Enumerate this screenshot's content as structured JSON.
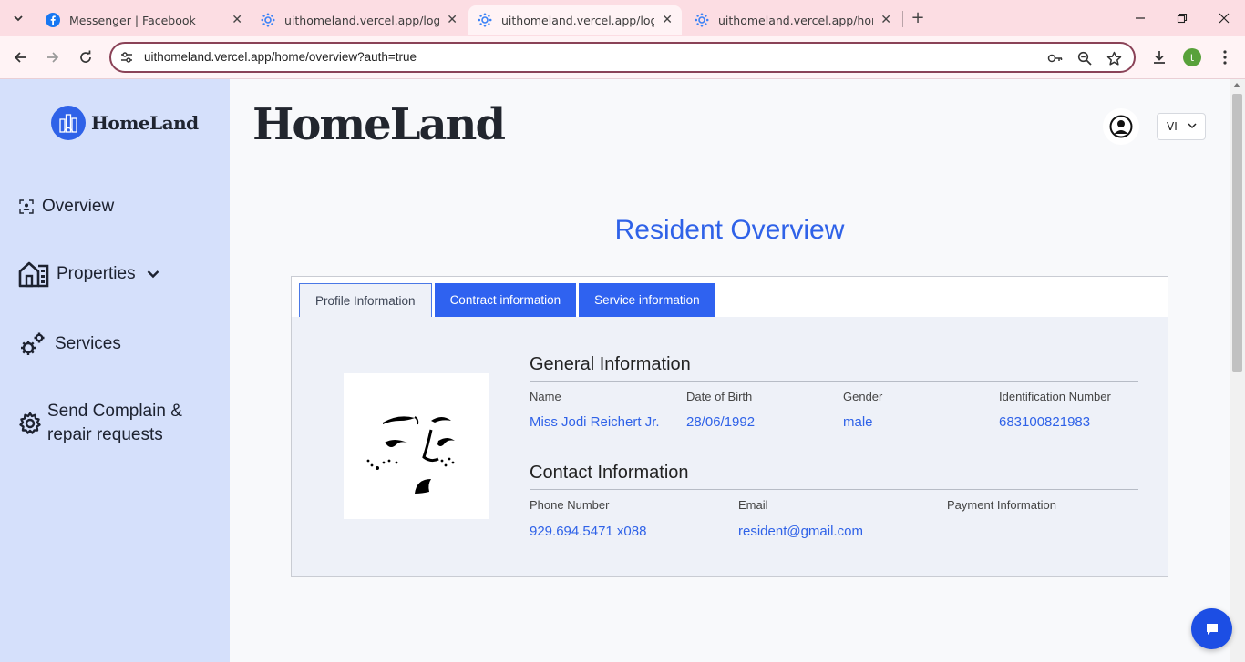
{
  "browser": {
    "tabs": [
      {
        "title": "Messenger | Facebook",
        "active": false,
        "favicon": "facebook-icon"
      },
      {
        "title": "uithomeland.vercel.app/login",
        "active": false,
        "favicon": "vercel-gear-icon"
      },
      {
        "title": "uithomeland.vercel.app/login",
        "active": true,
        "favicon": "vercel-gear-icon"
      },
      {
        "title": "uithomeland.vercel.app/home/o",
        "active": false,
        "favicon": "vercel-gear-icon"
      }
    ],
    "url": "uithomeland.vercel.app/home/overview?auth=true",
    "profile_initial": "t",
    "accent": "#fcdde3"
  },
  "sidebar": {
    "logo_text": "HomeLand",
    "items": [
      {
        "label": "Overview",
        "icon": "overview-icon"
      },
      {
        "label": "Properties",
        "icon": "building-icon",
        "has_dropdown": true
      },
      {
        "label": "Services",
        "icon": "gears-icon"
      },
      {
        "label_line1": "Send Complain &",
        "label_line2": "repair requests",
        "icon": "settings-icon"
      }
    ]
  },
  "header": {
    "brand": "HomeLand",
    "language": "VI"
  },
  "main": {
    "title": "Resident Overview",
    "tabs": [
      {
        "label": "Profile Information",
        "active": true
      },
      {
        "label": "Contract information",
        "active": false
      },
      {
        "label": "Service information",
        "active": false
      }
    ],
    "general": {
      "heading": "General Information",
      "fields": [
        {
          "label": "Name",
          "value": "Miss Jodi Reichert Jr."
        },
        {
          "label": "Date of Birth",
          "value": "28/06/1992"
        },
        {
          "label": "Gender",
          "value": "male"
        },
        {
          "label": "Identification Number",
          "value": "683100821983"
        }
      ]
    },
    "contact": {
      "heading": "Contact Information",
      "fields": [
        {
          "label": "Phone Number",
          "value": "929.694.5471 x088"
        },
        {
          "label": "Email",
          "value": "resident@gmail.com"
        },
        {
          "label": "Payment Information",
          "value": ""
        }
      ]
    }
  },
  "colors": {
    "primary": "#2f62e8",
    "sidebar_bg": "#d5e0fb",
    "tab_inactive_bg": "#2f62f0"
  }
}
